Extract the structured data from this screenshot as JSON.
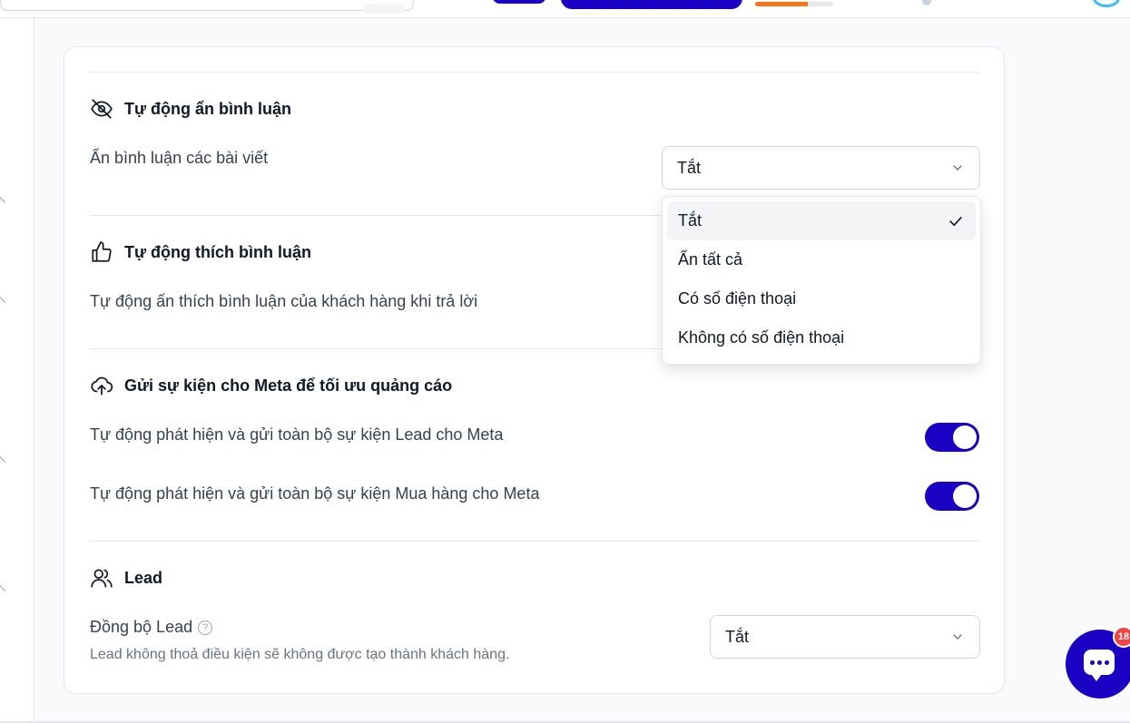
{
  "colors": {
    "accent": "#1a00c2",
    "progress": "#f97316",
    "badge": "#ef4444"
  },
  "header": {
    "progress_fraction": 0.67
  },
  "sections": {
    "auto_hide": {
      "icon": "eye-off-icon",
      "title": "Tự động ẩn bình luận",
      "label": "Ẩn bình luận các bài viết",
      "select_value": "Tắt"
    },
    "auto_like": {
      "icon": "thumbs-up-icon",
      "title": "Tự động thích bình luận",
      "label": "Tự động ấn thích bình luận của khách hàng khi trả lời"
    },
    "meta_events": {
      "icon": "cloud-upload-icon",
      "title": "Gửi sự kiện cho Meta để tối ưu quảng cáo",
      "lead_label": "Tự động phát hiện và gửi toàn bộ sự kiện Lead cho Meta",
      "lead_enabled": true,
      "purchase_label": "Tự động phát hiện và gửi toàn bộ sự kiện Mua hàng cho Meta",
      "purchase_enabled": true
    },
    "lead": {
      "icon": "users-icon",
      "title": "Lead",
      "label": "Đồng bộ Lead",
      "help_icon": "question-circle-icon",
      "help_glyph": "?",
      "description": "Lead không thoả điều kiện sẽ không được tạo thành khách hàng.",
      "select_value": "Tắt"
    }
  },
  "dropdown": {
    "options": [
      {
        "label": "Tắt",
        "selected": true
      },
      {
        "label": "Ẩn tất cả",
        "selected": false
      },
      {
        "label": "Có số điện thoại",
        "selected": false
      },
      {
        "label": "Không có số điện thoại",
        "selected": false
      }
    ]
  },
  "chat": {
    "icon": "chat-bubble-icon",
    "badge_count": "18"
  }
}
